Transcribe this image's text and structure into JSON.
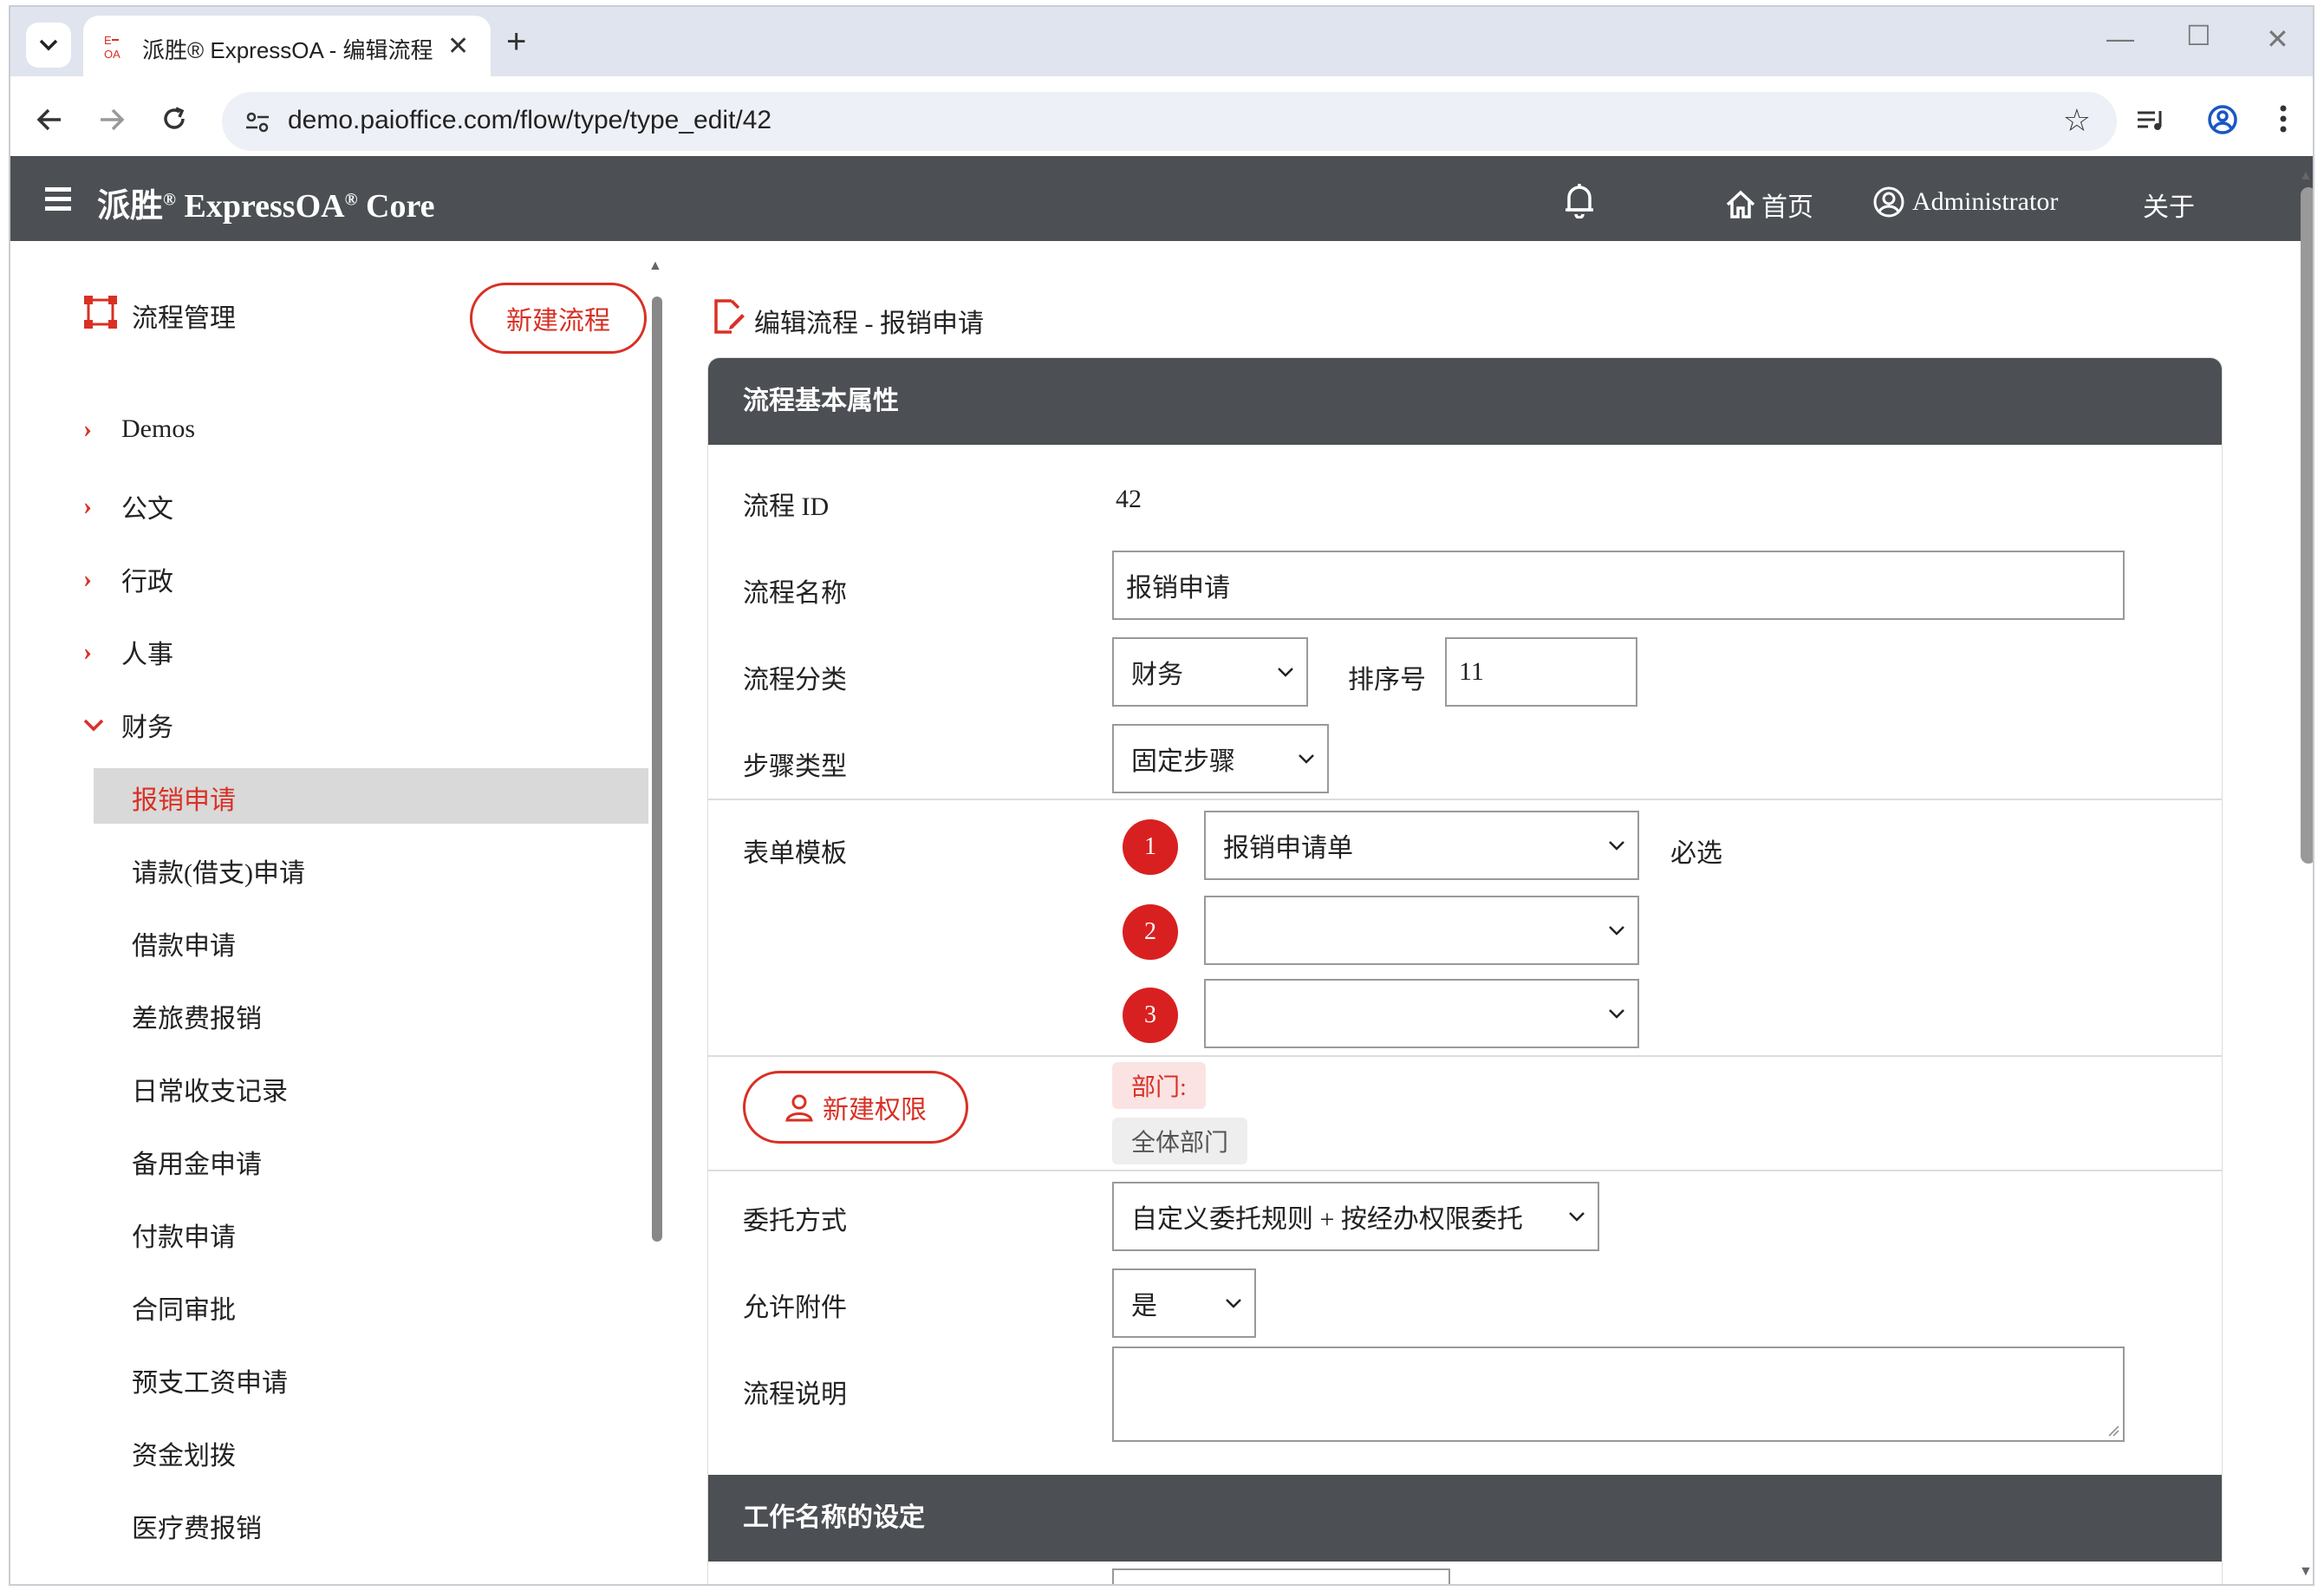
{
  "browser": {
    "tab_title": "派胜® ExpressOA - 编辑流程",
    "tab_close": "✕",
    "new_tab": "+",
    "url": "demo.paioffice.com/flow/type/type_edit/42",
    "favicon_text": "E\nOA"
  },
  "app": {
    "brand": "派胜",
    "brand_rest": " ExpressOA",
    "brand_core": " Core",
    "reg_mark": "®",
    "nav_home": "首页",
    "nav_user": "Administrator",
    "nav_about": "关于",
    "accent_color": "#d93025",
    "header_color": "#4c5054"
  },
  "sidebar": {
    "title": "流程管理",
    "new_flow_button": "新建流程",
    "categories": [
      {
        "label": "Demos",
        "expanded": false
      },
      {
        "label": "公文",
        "expanded": false
      },
      {
        "label": "行政",
        "expanded": false
      },
      {
        "label": "人事",
        "expanded": false
      },
      {
        "label": "财务",
        "expanded": true
      }
    ],
    "sub_items": [
      "报销申请",
      "请款(借支)申请",
      "借款申请",
      "差旅费报销",
      "日常收支记录",
      "备用金申请",
      "付款申请",
      "合同审批",
      "预支工资申请",
      "资金划拨",
      "医疗费报销"
    ],
    "active_item": "报销申请"
  },
  "main": {
    "breadcrumb": "编辑流程 - 报销申请",
    "section1_title": "流程基本属性",
    "labels": {
      "flow_id": "流程 ID",
      "flow_name": "流程名称",
      "flow_category": "流程分类",
      "sort_no": "排序号",
      "step_type": "步骤类型",
      "form_template": "表单模板",
      "delegation": "委托方式",
      "allow_attach": "允许附件",
      "description": "流程说明",
      "required": "必选"
    },
    "values": {
      "flow_id": "42",
      "flow_name": "报销申请",
      "flow_category": "财务",
      "sort_no": "11",
      "step_type": "固定步骤",
      "form1": "报销申请单",
      "form2": "",
      "form3": "",
      "delegation": "自定义委托规则 + 按经办权限委托",
      "allow_attach": "是",
      "description": ""
    },
    "form_badges": [
      "1",
      "2",
      "3"
    ],
    "permission_button": "新建权限",
    "permission_dept_label": "部门:",
    "permission_dept_value": "全体部门",
    "section2_title": "工作名称的设定"
  }
}
